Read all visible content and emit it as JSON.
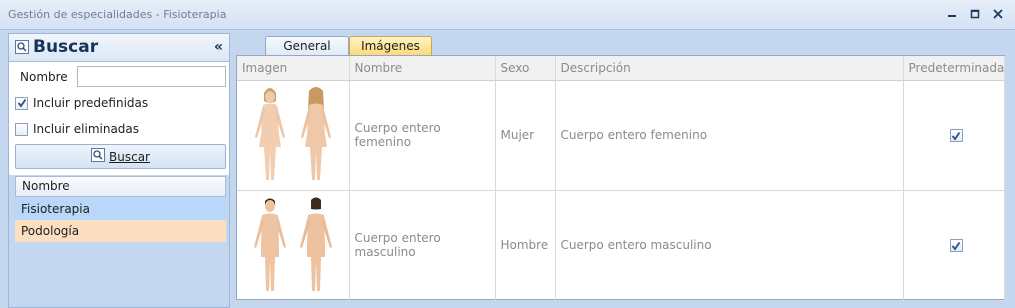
{
  "window": {
    "title": "Gestión de especialidades - Fisioterapia"
  },
  "search_panel": {
    "title": "Buscar",
    "nombre_label": "Nombre",
    "nombre_value": "",
    "incluir_predefinidas_label": "Incluir predefinidas",
    "incluir_predefinidas_checked": true,
    "incluir_eliminadas_label": "Incluir eliminadas",
    "incluir_eliminadas_checked": false,
    "search_button_label": "Buscar",
    "list_header": "Nombre",
    "items": [
      {
        "label": "Fisioterapia",
        "state": "selected"
      },
      {
        "label": "Podología",
        "state": "alternate"
      }
    ]
  },
  "tabs": [
    {
      "label": "General",
      "active": false
    },
    {
      "label": "Imágenes",
      "active": true
    }
  ],
  "grid": {
    "columns": [
      "Imagen",
      "Nombre",
      "Sexo",
      "Descripción",
      "Predeterminada"
    ],
    "rows": [
      {
        "nombre": "Cuerpo entero femenino",
        "sexo": "Mujer",
        "descripcion": "Cuerpo entero femenino",
        "predeterminada": true,
        "figure": "female-body-image"
      },
      {
        "nombre": "Cuerpo entero masculino",
        "sexo": "Hombre",
        "descripcion": "Cuerpo entero masculino",
        "predeterminada": true,
        "figure": "male-body-image"
      }
    ]
  },
  "colors": {
    "selected_item": "#b9d7f9",
    "alternate_item": "#fcdfc0",
    "active_tab": "#fcd974",
    "panel_background": "#c4d7ef"
  }
}
